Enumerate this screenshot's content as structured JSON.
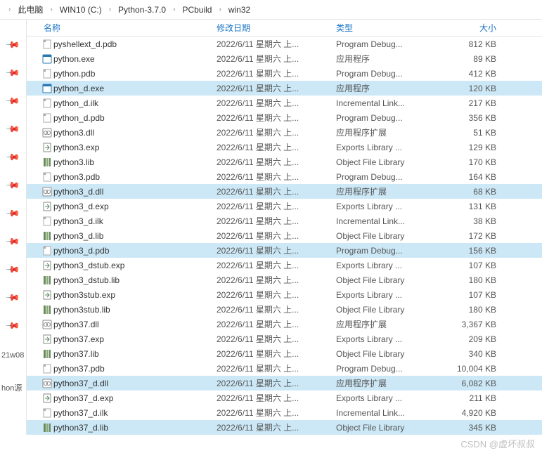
{
  "breadcrumb": {
    "items": [
      "此电脑",
      "WIN10 (C:)",
      "Python-3.7.0",
      "PCbuild",
      "win32"
    ],
    "separator": "›"
  },
  "columns": {
    "name": "名称",
    "date": "修改日期",
    "type": "类型",
    "size": "大小"
  },
  "sidebar_labels": {
    "a": "21w08",
    "b": "hon源"
  },
  "icons": {
    "pdb": "pdb",
    "exe": "exe",
    "ilk": "ilk",
    "dll": "dll",
    "exp": "exp",
    "lib": "lib"
  },
  "files": [
    {
      "name": "pyshellext_d.pdb",
      "date": "2022/6/11 星期六 上...",
      "type": "Program Debug...",
      "size": "812 KB",
      "icon": "pdb",
      "selected": false
    },
    {
      "name": "python.exe",
      "date": "2022/6/11 星期六 上...",
      "type": "应用程序",
      "size": "89 KB",
      "icon": "exe",
      "selected": false
    },
    {
      "name": "python.pdb",
      "date": "2022/6/11 星期六 上...",
      "type": "Program Debug...",
      "size": "412 KB",
      "icon": "pdb",
      "selected": false
    },
    {
      "name": "python_d.exe",
      "date": "2022/6/11 星期六 上...",
      "type": "应用程序",
      "size": "120 KB",
      "icon": "exe",
      "selected": true
    },
    {
      "name": "python_d.ilk",
      "date": "2022/6/11 星期六 上...",
      "type": "Incremental Link...",
      "size": "217 KB",
      "icon": "ilk",
      "selected": false
    },
    {
      "name": "python_d.pdb",
      "date": "2022/6/11 星期六 上...",
      "type": "Program Debug...",
      "size": "356 KB",
      "icon": "pdb",
      "selected": false
    },
    {
      "name": "python3.dll",
      "date": "2022/6/11 星期六 上...",
      "type": "应用程序扩展",
      "size": "51 KB",
      "icon": "dll",
      "selected": false
    },
    {
      "name": "python3.exp",
      "date": "2022/6/11 星期六 上...",
      "type": "Exports Library ...",
      "size": "129 KB",
      "icon": "exp",
      "selected": false
    },
    {
      "name": "python3.lib",
      "date": "2022/6/11 星期六 上...",
      "type": "Object File Library",
      "size": "170 KB",
      "icon": "lib",
      "selected": false
    },
    {
      "name": "python3.pdb",
      "date": "2022/6/11 星期六 上...",
      "type": "Program Debug...",
      "size": "164 KB",
      "icon": "pdb",
      "selected": false
    },
    {
      "name": "python3_d.dll",
      "date": "2022/6/11 星期六 上...",
      "type": "应用程序扩展",
      "size": "68 KB",
      "icon": "dll",
      "selected": true
    },
    {
      "name": "python3_d.exp",
      "date": "2022/6/11 星期六 上...",
      "type": "Exports Library ...",
      "size": "131 KB",
      "icon": "exp",
      "selected": false
    },
    {
      "name": "python3_d.ilk",
      "date": "2022/6/11 星期六 上...",
      "type": "Incremental Link...",
      "size": "38 KB",
      "icon": "ilk",
      "selected": false
    },
    {
      "name": "python3_d.lib",
      "date": "2022/6/11 星期六 上...",
      "type": "Object File Library",
      "size": "172 KB",
      "icon": "lib",
      "selected": false
    },
    {
      "name": "python3_d.pdb",
      "date": "2022/6/11 星期六 上...",
      "type": "Program Debug...",
      "size": "156 KB",
      "icon": "pdb",
      "selected": true
    },
    {
      "name": "python3_dstub.exp",
      "date": "2022/6/11 星期六 上...",
      "type": "Exports Library ...",
      "size": "107 KB",
      "icon": "exp",
      "selected": false
    },
    {
      "name": "python3_dstub.lib",
      "date": "2022/6/11 星期六 上...",
      "type": "Object File Library",
      "size": "180 KB",
      "icon": "lib",
      "selected": false
    },
    {
      "name": "python3stub.exp",
      "date": "2022/6/11 星期六 上...",
      "type": "Exports Library ...",
      "size": "107 KB",
      "icon": "exp",
      "selected": false
    },
    {
      "name": "python3stub.lib",
      "date": "2022/6/11 星期六 上...",
      "type": "Object File Library",
      "size": "180 KB",
      "icon": "lib",
      "selected": false
    },
    {
      "name": "python37.dll",
      "date": "2022/6/11 星期六 上...",
      "type": "应用程序扩展",
      "size": "3,367 KB",
      "icon": "dll",
      "selected": false
    },
    {
      "name": "python37.exp",
      "date": "2022/6/11 星期六 上...",
      "type": "Exports Library ...",
      "size": "209 KB",
      "icon": "exp",
      "selected": false
    },
    {
      "name": "python37.lib",
      "date": "2022/6/11 星期六 上...",
      "type": "Object File Library",
      "size": "340 KB",
      "icon": "lib",
      "selected": false
    },
    {
      "name": "python37.pdb",
      "date": "2022/6/11 星期六 上...",
      "type": "Program Debug...",
      "size": "10,004 KB",
      "icon": "pdb",
      "selected": false
    },
    {
      "name": "python37_d.dll",
      "date": "2022/6/11 星期六 上...",
      "type": "应用程序扩展",
      "size": "6,082 KB",
      "icon": "dll",
      "selected": true
    },
    {
      "name": "python37_d.exp",
      "date": "2022/6/11 星期六 上...",
      "type": "Exports Library ...",
      "size": "211 KB",
      "icon": "exp",
      "selected": false
    },
    {
      "name": "python37_d.ilk",
      "date": "2022/6/11 星期六 上...",
      "type": "Incremental Link...",
      "size": "4,920 KB",
      "icon": "ilk",
      "selected": false
    },
    {
      "name": "python37_d.lib",
      "date": "2022/6/11 星期六 上...",
      "type": "Object File Library",
      "size": "345 KB",
      "icon": "lib",
      "selected": true
    }
  ],
  "watermark": "CSDN @虚坏叔叔"
}
